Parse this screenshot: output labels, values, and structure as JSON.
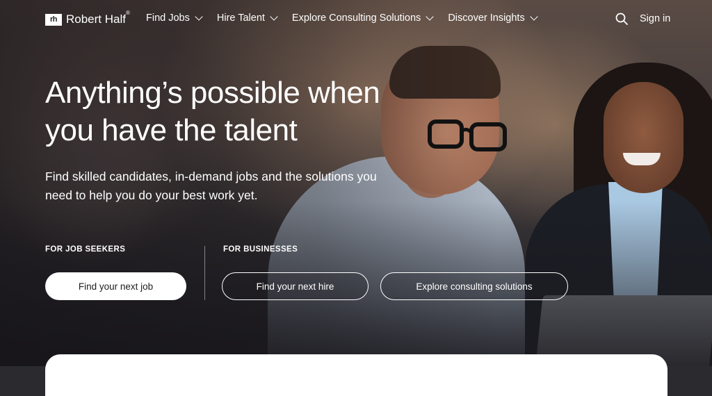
{
  "brand": {
    "name": "Robert Half",
    "mark": "rh",
    "registered": "®"
  },
  "nav": {
    "items": [
      {
        "label": "Find Jobs"
      },
      {
        "label": "Hire Talent"
      },
      {
        "label": "Explore Consulting Solutions"
      },
      {
        "label": "Discover Insights"
      }
    ],
    "sign_in": "Sign in"
  },
  "hero": {
    "headline": "Anything’s possible when you have the talent",
    "subtext": "Find skilled candidates, in-demand jobs and the solutions you need to help you do your best work yet."
  },
  "sections": {
    "job_seekers": {
      "label": "FOR JOB SEEKERS",
      "button": "Find your next job"
    },
    "businesses": {
      "label": "FOR BUSINESSES",
      "hire_button": "Find your next hire",
      "consult_button": "Explore consulting solutions"
    }
  },
  "colors": {
    "primary_button_bg": "#ffffff",
    "primary_button_text": "#1d1d1f",
    "text": "#ffffff"
  }
}
